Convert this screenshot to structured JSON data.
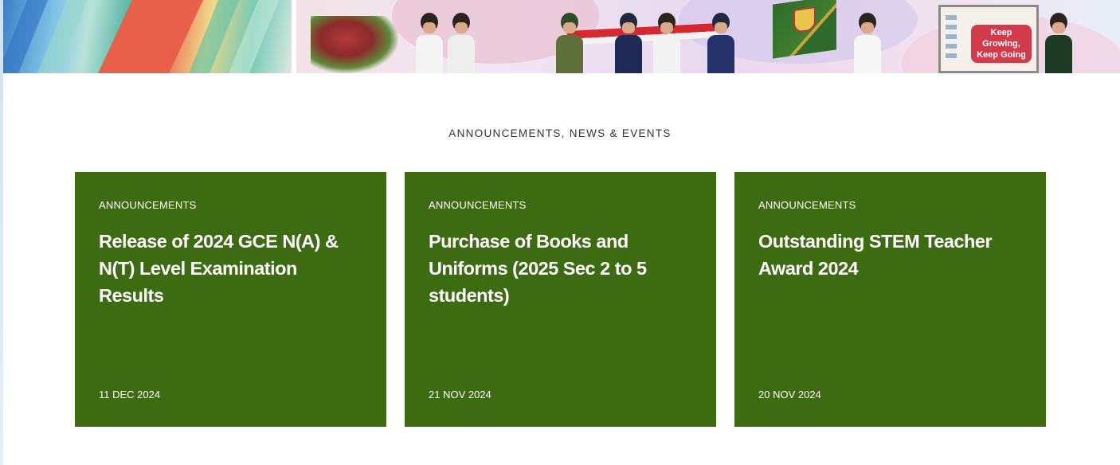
{
  "banner": {
    "board_text_line1": "Keep Growing,",
    "board_text_line2": "Keep Going"
  },
  "section": {
    "title": "ANNOUNCEMENTS, NEWS & EVENTS"
  },
  "cards": [
    {
      "category": "ANNOUNCEMENTS",
      "title": "Release of 2024 GCE N(A) & N(T) Level Examination Results",
      "date": "11 DEC 2024"
    },
    {
      "category": "ANNOUNCEMENTS",
      "title": "Purchase of Books and Uniforms (2025 Sec 2 to 5 students)",
      "date": "21 NOV 2024"
    },
    {
      "category": "ANNOUNCEMENTS",
      "title": "Outstanding STEM Teacher Award 2024",
      "date": "20 NOV 2024"
    }
  ],
  "colors": {
    "card_background": "#3d6b12",
    "card_text": "#ffffff",
    "section_title": "#333333"
  }
}
